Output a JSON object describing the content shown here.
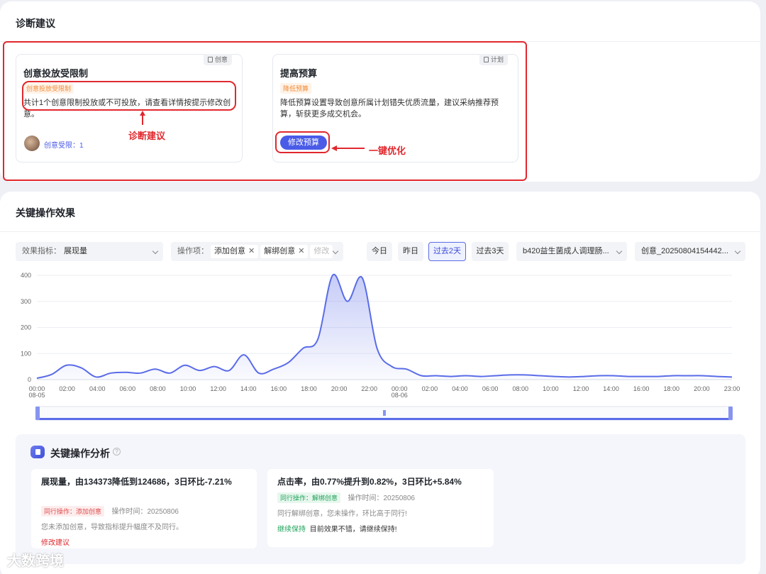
{
  "diagnosis": {
    "title": "诊断建议",
    "card1": {
      "title": "创意投放受限制",
      "corner_tag": "创意",
      "tag": "创意投放受限制",
      "desc": "共计1个创意限制投放或不可投放，请查看详情按提示修改创意。",
      "footer": "创意受限：1"
    },
    "card2": {
      "title": "提高预算",
      "corner_tag": "计划",
      "tag": "降低预算",
      "desc": "降低预算设置导致创意所属计划错失优质流量，建议采纳推荐预算，斩获更多成交机会。",
      "button": "修改预算"
    },
    "annotation_left": "诊断建议",
    "annotation_right": "一键优化"
  },
  "effect": {
    "title": "关键操作效果",
    "metric_label": "效果指标：",
    "metric_value": "展现量",
    "op_label": "操作项：",
    "op_chips": [
      "添加创意",
      "解绑创意"
    ],
    "op_more": "修改",
    "date_buttons": [
      "今日",
      "昨日",
      "过去2天",
      "过去3天"
    ],
    "active_date": "过去2天",
    "product_select": "b420益生菌成人调理肠...",
    "creative_select": "创意_20250804154442..."
  },
  "chart_data": {
    "type": "area",
    "ylim": [
      0,
      400
    ],
    "y_ticks": [
      "400",
      "300",
      "200",
      "100",
      "0"
    ],
    "x_ticks": [
      "00:00",
      "02:00",
      "04:00",
      "06:00",
      "08:00",
      "10:00",
      "12:00",
      "14:00",
      "16:00",
      "18:00",
      "20:00",
      "22:00",
      "00:00",
      "02:00",
      "04:00",
      "06:00",
      "08:00",
      "10:00",
      "12:00",
      "14:00",
      "16:00",
      "18:00",
      "20:00",
      "23:00"
    ],
    "date_labels": [
      "08-05",
      "08-06"
    ],
    "x": [
      "08-05 00:00",
      "08-05 01:00",
      "08-05 02:00",
      "08-05 03:00",
      "08-05 04:00",
      "08-05 05:00",
      "08-05 06:00",
      "08-05 07:00",
      "08-05 08:00",
      "08-05 09:00",
      "08-05 10:00",
      "08-05 11:00",
      "08-05 12:00",
      "08-05 13:00",
      "08-05 14:00",
      "08-05 15:00",
      "08-05 16:00",
      "08-05 17:00",
      "08-05 18:00",
      "08-05 19:00",
      "08-05 20:00",
      "08-05 21:00",
      "08-05 22:00",
      "08-05 23:00",
      "08-06 00:00",
      "08-06 01:00",
      "08-06 02:00",
      "08-06 03:00",
      "08-06 04:00",
      "08-06 05:00",
      "08-06 06:00",
      "08-06 07:00",
      "08-06 08:00",
      "08-06 09:00",
      "08-06 10:00",
      "08-06 11:00",
      "08-06 12:00",
      "08-06 13:00",
      "08-06 14:00",
      "08-06 15:00",
      "08-06 16:00",
      "08-06 17:00",
      "08-06 18:00",
      "08-06 19:00",
      "08-06 20:00",
      "08-06 21:00",
      "08-06 22:00",
      "08-06 23:00"
    ],
    "values": [
      5,
      20,
      55,
      45,
      10,
      25,
      28,
      25,
      40,
      25,
      55,
      35,
      50,
      35,
      95,
      25,
      40,
      65,
      120,
      155,
      400,
      300,
      390,
      120,
      50,
      40,
      15,
      15,
      12,
      15,
      12,
      15,
      18,
      18,
      15,
      12,
      10,
      12,
      15,
      15,
      12,
      12,
      12,
      15,
      15,
      15,
      12,
      10
    ]
  },
  "analysis": {
    "title": "关键操作分析",
    "card1": {
      "headline": "展现量，由134373降低到124686，3日环比-7.21%",
      "tag": "同行操作：添加创意",
      "time": "操作时间：20250806",
      "note": "您未添加创意，导致指标提升幅度不及同行。",
      "advice_label": "修改建议"
    },
    "card2": {
      "headline": "点击率，由0.77%提升到0.82%，3日环比+5.84%",
      "tag": "同行操作：解绑创意",
      "time": "操作时间：20250806",
      "note": "同行解绑创意，您未操作，环比高于同行!",
      "keep_label": "继续保持",
      "keep_text": "目前效果不错，请继续保持!"
    }
  },
  "watermark": "大数跨境",
  "colors": {
    "accent": "#4a5be8",
    "annotation": "#e0282e",
    "line": "#5a6ce8"
  }
}
